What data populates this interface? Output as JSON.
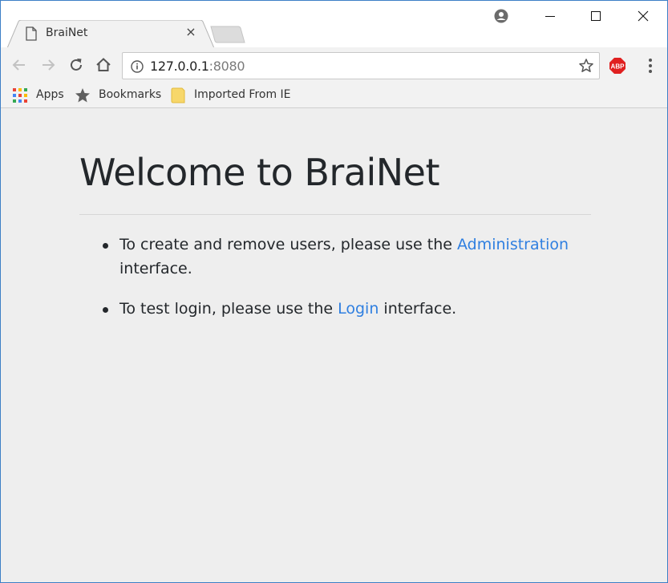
{
  "tab": {
    "title": "BraiNet",
    "close_glyph": "×"
  },
  "address_bar": {
    "host": "127.0.0.1",
    "port": ":8080"
  },
  "extensions": {
    "abp_label": "ABP"
  },
  "bookmarks": [
    {
      "label": "Apps",
      "icon": "apps-grid-icon"
    },
    {
      "label": "Bookmarks",
      "icon": "star-icon"
    },
    {
      "label": "Imported From IE",
      "icon": "folder-icon"
    }
  ],
  "page": {
    "heading": "Welcome to BraiNet",
    "items": [
      {
        "before": "To create and remove users, please use the ",
        "link": "Administration",
        "after": " interface."
      },
      {
        "before": "To test login, please use the ",
        "link": "Login",
        "after": " interface."
      }
    ]
  },
  "colors": {
    "link": "#2f7fe0",
    "window_border": "#3d7fc6",
    "page_background": "#eeeeee",
    "abp_red": "#e02020"
  }
}
